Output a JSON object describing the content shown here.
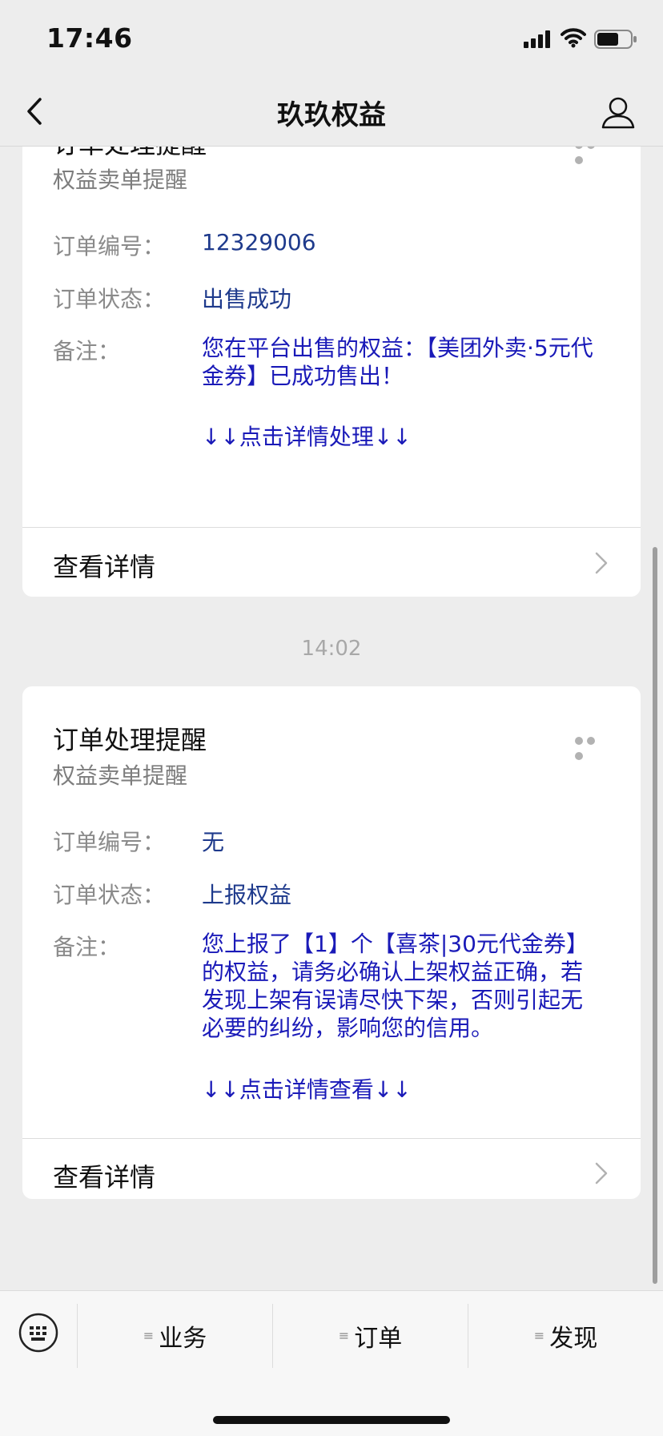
{
  "status_bar": {
    "time": "17:46"
  },
  "header": {
    "title": "玖玖权益"
  },
  "cards": [
    {
      "title": "订单处理提醒",
      "subtitle": "权益卖单提醒",
      "order_no_label": "订单编号：",
      "order_no": "12329006",
      "status_label": "订单状态：",
      "status": "出售成功",
      "note_label": "备注：",
      "note": "您在平台出售的权益：【美团外卖·5元代金券】已成功售出！",
      "action_hint": "↓↓点击详情处理↓↓",
      "detail_label": "查看详情"
    },
    {
      "title": "订单处理提醒",
      "subtitle": "权益卖单提醒",
      "order_no_label": "订单编号：",
      "order_no": "无",
      "status_label": "订单状态：",
      "status": "上报权益",
      "note_label": "备注：",
      "note": "您上报了【1】个【喜茶|30元代金券】的权益，请务必确认上架权益正确，若发现上架有误请尽快下架，否则引起无必要的纠纷，影响您的信用。",
      "action_hint": "↓↓点击详情查看↓↓",
      "detail_label": "查看详情"
    }
  ],
  "timestamp": "14:02",
  "bottom_menu": {
    "items": [
      {
        "label": "业务"
      },
      {
        "label": "订单"
      },
      {
        "label": "发现"
      }
    ]
  },
  "colors": {
    "link_blue": "#1a1ab8",
    "value_blue": "#1e3a8c",
    "background": "#ededed"
  },
  "icons": [
    "back-icon",
    "user-icon",
    "more-icon",
    "chevron-right-icon",
    "keyboard-icon"
  ]
}
